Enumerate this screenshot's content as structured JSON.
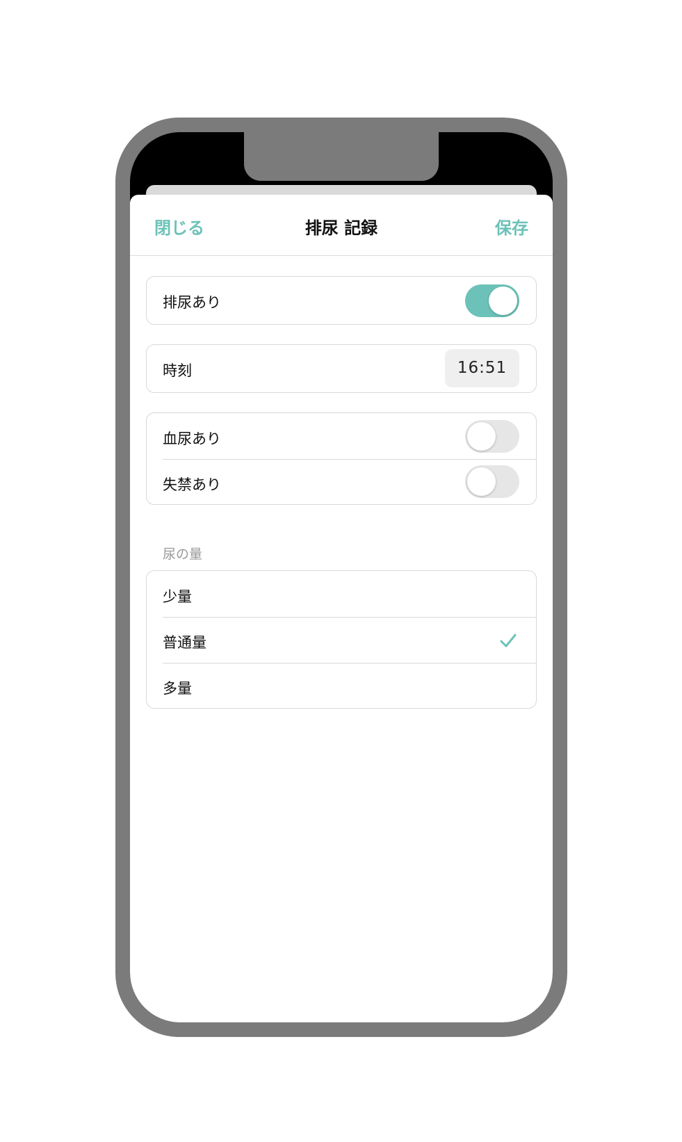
{
  "nav": {
    "close_label": "閉じる",
    "title": "排尿 記録",
    "save_label": "保存"
  },
  "urination": {
    "label": "排尿あり",
    "enabled": true
  },
  "time": {
    "label": "時刻",
    "value": "16:51"
  },
  "flags": [
    {
      "label": "血尿あり",
      "enabled": false
    },
    {
      "label": "失禁あり",
      "enabled": false
    }
  ],
  "amount": {
    "header": "尿の量",
    "options": [
      {
        "label": "少量",
        "selected": false
      },
      {
        "label": "普通量",
        "selected": true
      },
      {
        "label": "多量",
        "selected": false
      }
    ]
  },
  "colors": {
    "accent": "#6cc2b8",
    "frame": "#7b7b7b",
    "toggle_off": "#e6e6e6"
  }
}
